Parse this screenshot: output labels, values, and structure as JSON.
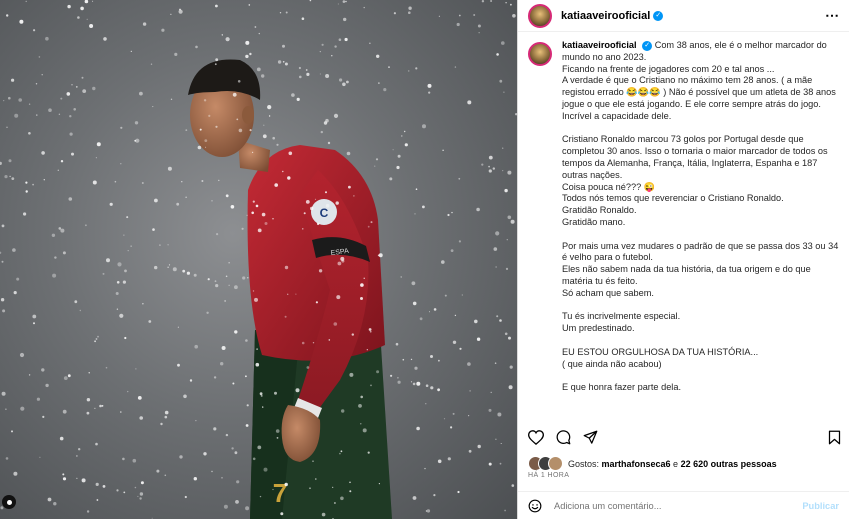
{
  "post": {
    "username": "katiaaveirooficial",
    "more_icon": "more-horizontal-icon"
  },
  "caption": {
    "username": "katiaaveirooficial",
    "lines": [
      "Com 38 anos, ele é o melhor marcador do mundo no ano 2023.",
      "Ficando na frente de jogadores com 20 e tal anos ...",
      "A verdade é que o Cristiano no máximo tem 28 anos. ( a mãe registou errado 😂😂😂 ) Não é possível que um atleta de 38 anos jogue o que ele está jogando. E ele corre sempre atrás do jogo. Incrível a capacidade dele.",
      "",
      "Cristiano Ronaldo marcou 73 golos por Portugal desde que completou 30 anos. Isso o tornaria o maior marcador de todos os tempos da Alemanha, França, Itália, Inglaterra, Espanha e 187 outras nações.",
      "Coisa pouca né??? 😜",
      "Todos nós temos que reverenciar o Cristiano Ronaldo.",
      "Gratidão Ronaldo.",
      "Gratidão mano.",
      "",
      "Por mais uma vez mudares o padrão de que se passa dos 33 ou 34 é velho para o futebol.",
      "Eles não sabem nada da tua história, da tua origem e do que matéria tu és feito.",
      "Só acham que sabem.",
      "",
      "Tu és incrivelmente especial.",
      "Um predestinado.",
      "",
      "EU ESTOU ORGULHOSA DA TUA HISTÓRIA...",
      "( que ainda não acabou)",
      "",
      "E que honra fazer parte dela."
    ]
  },
  "actions": {
    "like_icon": "heart-icon",
    "comment_icon": "comment-icon",
    "share_icon": "share-icon",
    "save_icon": "bookmark-icon"
  },
  "likes": {
    "prefix": "Gostos: ",
    "first_user": "marthafonseca6",
    "suffix": " e ",
    "others": "22 620 outras pessoas"
  },
  "timestamp": "HÁ 1 HORA",
  "comment_box": {
    "placeholder": "Adiciona um comentário...",
    "post_label": "Publicar"
  },
  "photo": {
    "jersey_number": "7",
    "armband_text": "C",
    "sleeve_text": "ESPA"
  },
  "colors": {
    "verified": "#0095f6",
    "post_button": "#b2dffc",
    "jersey_red": "#b2212d",
    "shorts_green": "#1f3a25"
  }
}
